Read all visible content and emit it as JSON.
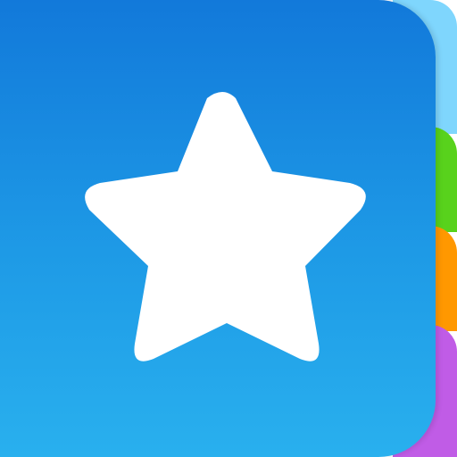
{
  "app_icon": {
    "icon": "star-icon",
    "colors": {
      "card_top": "#1279da",
      "card_bottom": "#29b0ee",
      "star": "#ffffff",
      "tab_blue": "#7fd6fd",
      "tab_green": "#58d21c",
      "tab_orange": "#ff9800",
      "tab_purple": "#c05ce6"
    },
    "tabs": [
      "tab-blue",
      "tab-green",
      "tab-orange",
      "tab-purple"
    ]
  }
}
